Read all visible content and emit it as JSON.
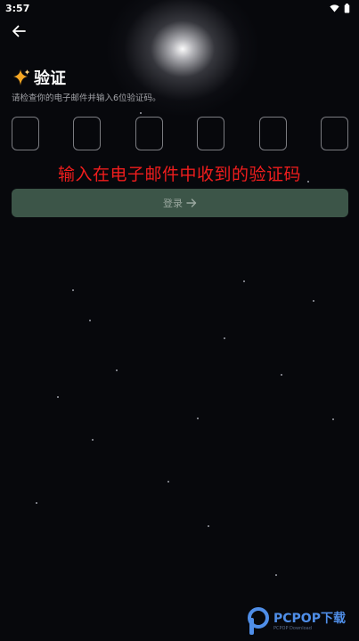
{
  "status_bar": {
    "time": "3:57"
  },
  "header": {
    "back_icon": "arrow-left-icon"
  },
  "title": {
    "icon": "sparkle-icon",
    "text": "验证",
    "accent_color": "#f5a623"
  },
  "subtitle": "请检查你的电子邮件并输入6位验证码。",
  "code_inputs": {
    "count": 6,
    "values": [
      "",
      "",
      "",
      "",
      "",
      ""
    ]
  },
  "annotation": {
    "text": "输入在电子邮件中收到的验证码",
    "color": "#f01d1d"
  },
  "login_button": {
    "label": "登录",
    "icon": "arrow-right-icon",
    "bg_color": "#3c5548"
  },
  "watermark": {
    "brand": "PCPOP下载",
    "tagline": "PCPOP Download"
  }
}
